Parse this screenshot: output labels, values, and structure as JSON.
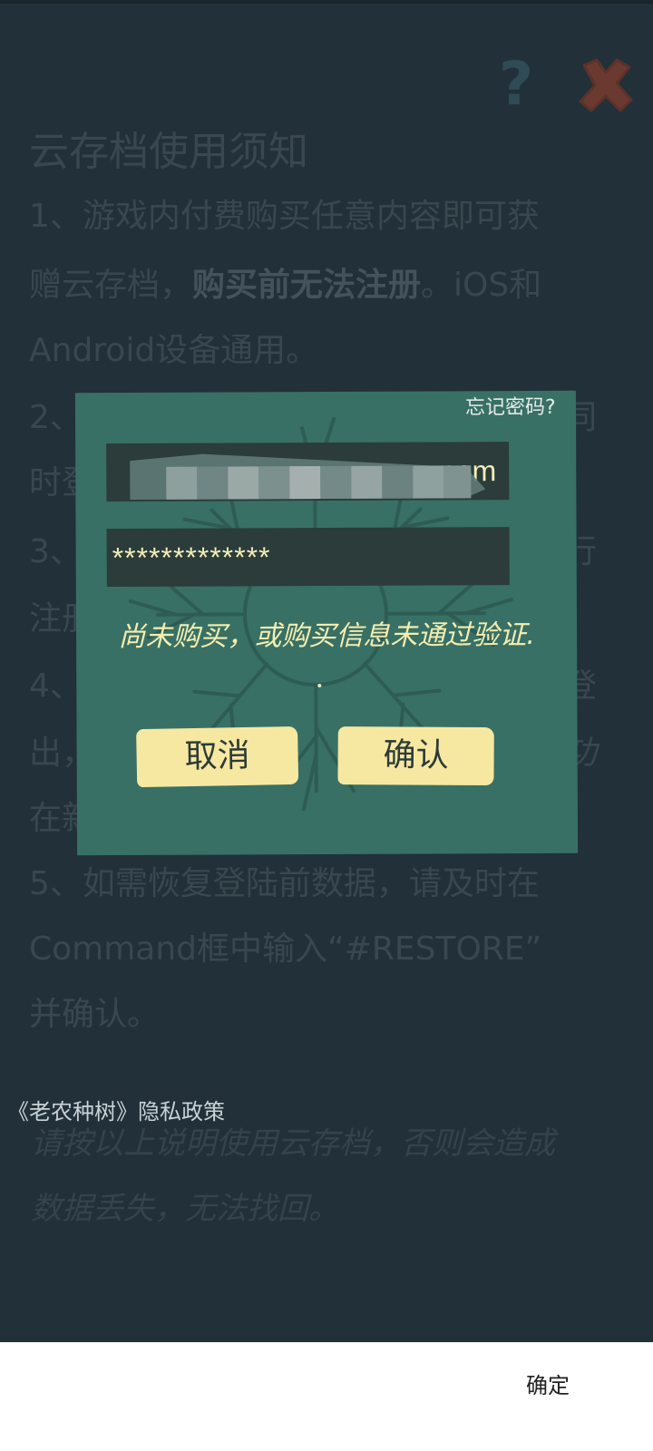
{
  "notice": {
    "title": "云存档使用须知",
    "lines": [
      "1、游戏内付费购买任意内容即可获",
      "赠云存档，",
      "购买前无法注册",
      "。iOS和",
      "Android设备通用。",
      "2、",
      "同",
      "时登",
      "3、",
      "行",
      "注册",
      "4、",
      "登",
      "出，",
      "功",
      "在新",
      "5、如需恢复登陆前数据，请及时在",
      "Command框中输入“#RESTORE”",
      "并确认。"
    ],
    "privacy_link": "《老农种树》隐私政策",
    "warning": [
      "请按以上说明使用云存档，否则会造成",
      "数据丢失，无法找回。"
    ]
  },
  "icons": {
    "help": "?",
    "help_name": "help-icon",
    "close_name": "close-icon"
  },
  "dialog": {
    "forgot_password": "忘记密码?",
    "email_value": ".com",
    "password_value": "*************",
    "status_message": "尚未购买，或购买信息未通过验证.",
    "dot": ".",
    "cancel_label": "取消",
    "confirm_label": "确认"
  },
  "system_bar": {
    "ok_label": "确定"
  },
  "colors": {
    "background": "#223039",
    "dialog": "#387065",
    "button": "#f6e8a1",
    "input_text": "#f3eeb8",
    "close_red": "#7a3b30"
  }
}
